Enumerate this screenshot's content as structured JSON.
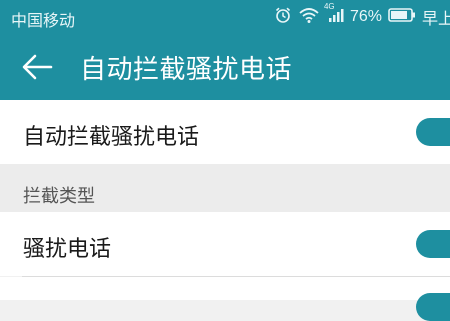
{
  "status_bar": {
    "carrier": "中国移动",
    "signal_tag": "4G",
    "battery_percent": "76%",
    "time": "早上",
    "icons": [
      "alarm-icon",
      "wifi-icon",
      "cell-signal-icon",
      "battery-icon"
    ]
  },
  "app_bar": {
    "title": "自动拦截骚扰电话",
    "back_icon": "arrow-left-icon"
  },
  "settings": {
    "auto_block": {
      "label": "自动拦截骚扰电话",
      "enabled": true
    },
    "section_title": "拦截类型",
    "items": [
      {
        "label": "骚扰电话",
        "enabled": true
      }
    ]
  },
  "colors": {
    "primary": "#1e8fa0",
    "background": "#f1f1f1",
    "row_background": "#ffffff"
  }
}
